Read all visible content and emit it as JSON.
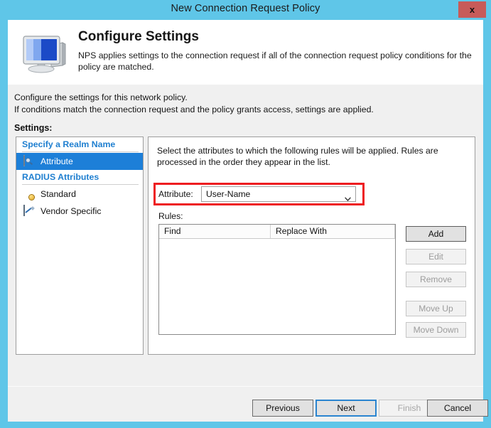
{
  "window": {
    "title": "New Connection Request Policy",
    "close_label": "x"
  },
  "header": {
    "icon": "computer-monitor-icon",
    "title": "Configure Settings",
    "description": "NPS applies settings to the connection request if all of the connection request policy conditions  for the policy are matched."
  },
  "body": {
    "intro_line1": "Configure the settings for this network policy.",
    "intro_line2": "If conditions match the connection request and the policy grants access, settings are applied.",
    "settings_label": "Settings:"
  },
  "tree": {
    "groups": [
      {
        "label": "Specify a Realm Name",
        "items": [
          {
            "label": "Attribute",
            "icon": "attribute-document-icon",
            "selected": true
          }
        ]
      },
      {
        "label": "RADIUS Attributes",
        "items": [
          {
            "label": "Standard",
            "icon": "globe-icon",
            "selected": false
          },
          {
            "label": "Vendor Specific",
            "icon": "pencil-panel-icon",
            "selected": false
          }
        ]
      }
    ]
  },
  "detail": {
    "description": "Select the attributes to which the following rules will be applied. Rules are processed in the order they appear in the list.",
    "attribute": {
      "label": "Attribute:",
      "value": "User-Name",
      "arrow_icon": "chevron-down-icon",
      "highlight_color": "#ee1c20"
    },
    "rules": {
      "label": "Rules:",
      "columns": [
        "Find",
        "Replace With"
      ],
      "rows": []
    },
    "side_buttons": [
      {
        "label": "Add",
        "enabled": true
      },
      {
        "label": "Edit",
        "enabled": false
      },
      {
        "label": "Remove",
        "enabled": false
      },
      {
        "label": "Move Up",
        "enabled": false
      },
      {
        "label": "Move Down",
        "enabled": false
      }
    ]
  },
  "footer": {
    "buttons": [
      {
        "label": "Previous",
        "state": "normal"
      },
      {
        "label": "Next",
        "state": "focused"
      },
      {
        "label": "Finish",
        "state": "disabled"
      },
      {
        "label": "Cancel",
        "state": "normal"
      }
    ]
  },
  "colors": {
    "titlebar": "#5fc6e8",
    "close_button": "#c75b59",
    "selection": "#1d7fd8",
    "group_text": "#1f7fd0",
    "highlight": "#ee1c20",
    "focus_border": "#2a85d0"
  }
}
